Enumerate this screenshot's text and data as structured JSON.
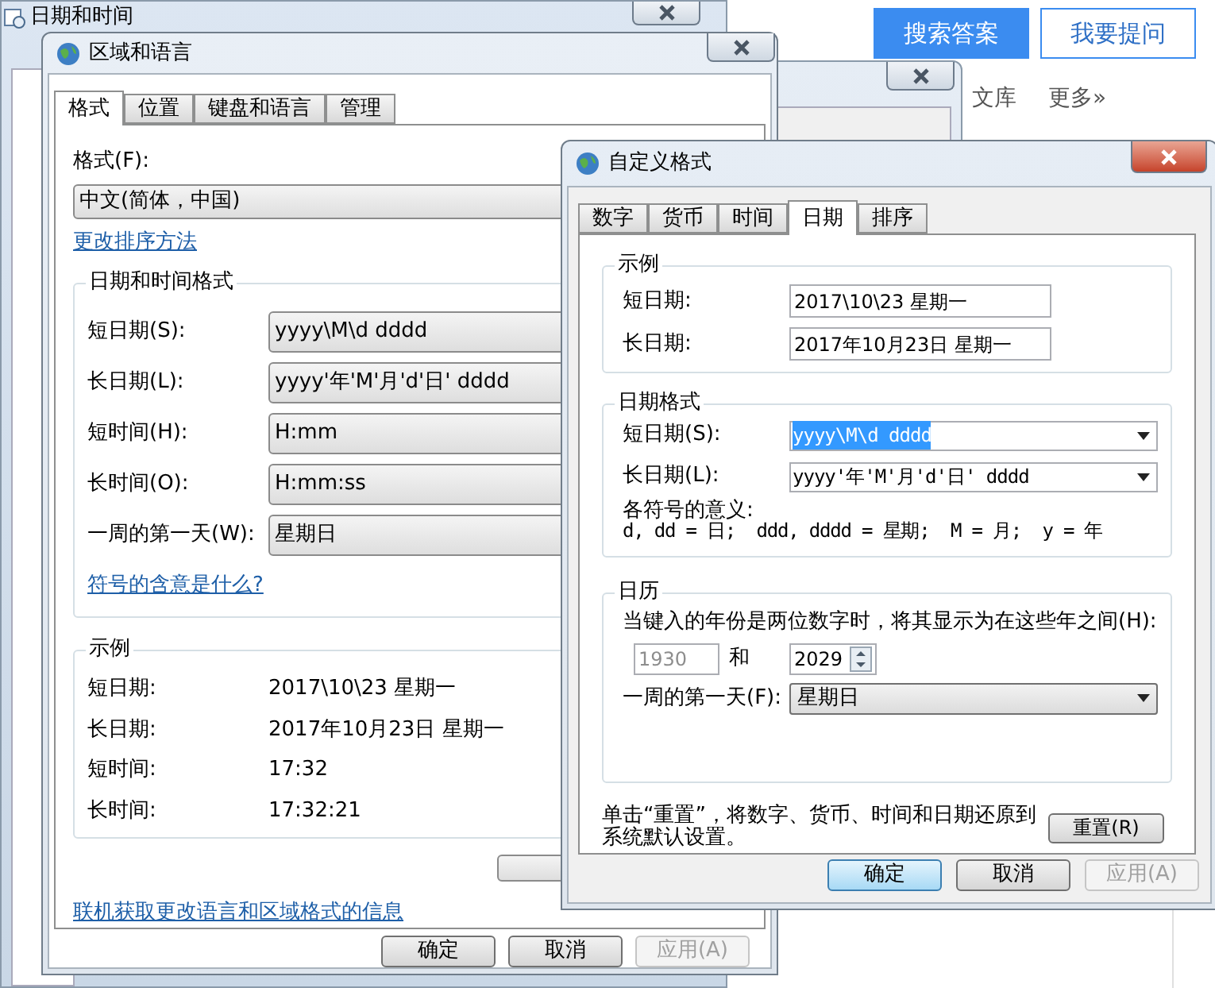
{
  "web_page": {
    "buttons": [
      {
        "label": "搜索答案",
        "kind": "primary"
      },
      {
        "label": "我要提问",
        "kind": "outline"
      }
    ],
    "nav_links": [
      "文库",
      "更多»"
    ]
  },
  "date_time_window": {
    "title": "日期和时间"
  },
  "region_dialog": {
    "title": "区域和语言",
    "tabs": [
      {
        "label": "格式",
        "selected": true
      },
      {
        "label": "位置",
        "selected": false
      },
      {
        "label": "键盘和语言",
        "selected": false
      },
      {
        "label": "管理",
        "selected": false
      }
    ],
    "format_label": "格式(F):",
    "format_value": "中文(简体，中国)",
    "sort_link": "更改排序方法",
    "formats_group": {
      "title": "日期和时间格式",
      "rows": [
        {
          "label": "短日期(S):",
          "value": "yyyy\\M\\d dddd"
        },
        {
          "label": "长日期(L):",
          "value": "yyyy'年'M'月'd'日' dddd"
        },
        {
          "label": "短时间(H):",
          "value": "H:mm"
        },
        {
          "label": "长时间(O):",
          "value": "H:mm:ss"
        },
        {
          "label": "一周的第一天(W):",
          "value": "星期日"
        }
      ]
    },
    "symbols_link": "符号的含意是什么?",
    "example_group": {
      "title": "示例",
      "rows": [
        {
          "label": "短日期:",
          "value": "2017\\10\\23 星期一"
        },
        {
          "label": "长日期:",
          "value": "2017年10月23日 星期一"
        },
        {
          "label": "短时间:",
          "value": "17:32"
        },
        {
          "label": "长时间:",
          "value": "17:32:21"
        }
      ]
    },
    "online_link": "联机获取更改语言和区域格式的信息",
    "buttons": [
      {
        "label": "确定",
        "disabled": false
      },
      {
        "label": "取消",
        "disabled": false
      },
      {
        "label": "应用(A)",
        "disabled": true
      }
    ]
  },
  "custom_dialog": {
    "title": "自定义格式",
    "tabs": [
      {
        "label": "数字",
        "selected": false
      },
      {
        "label": "货币",
        "selected": false
      },
      {
        "label": "时间",
        "selected": false
      },
      {
        "label": "日期",
        "selected": true
      },
      {
        "label": "排序",
        "selected": false
      }
    ],
    "example_group": {
      "title": "示例",
      "rows": [
        {
          "label": "短日期:",
          "value": "2017\\10\\23 星期一"
        },
        {
          "label": "长日期:",
          "value": "2017年10月23日 星期一"
        }
      ]
    },
    "format_group": {
      "title": "日期格式",
      "rows": [
        {
          "label": "短日期(S):",
          "value": "yyyy\\M\\d dddd",
          "text_selected": true
        },
        {
          "label": "长日期(L):",
          "value": "yyyy'年'M'月'd'日' dddd",
          "text_selected": false
        }
      ],
      "legend_title": "各符号的意义:",
      "legend_text": "d, dd = 日;  ddd, dddd = 星期;  M = 月;  y = 年"
    },
    "calendar_group": {
      "title": "日历",
      "range_text": "当键入的年份是两位数字时，将其显示为在这些年之间(H):",
      "from_year": {
        "value": "1930",
        "disabled": true
      },
      "and_label": "和",
      "to_year": {
        "value": "2029",
        "disabled": false
      },
      "first_day_label": "一周的第一天(F):",
      "first_day_value": "星期日"
    },
    "reset_text": "单击“重置”，将数字、货币、时间和日期还原到系统默认设置。",
    "reset_button": "重置(R)",
    "buttons": [
      {
        "label": "确定",
        "disabled": false,
        "focused": true
      },
      {
        "label": "取消",
        "disabled": false,
        "focused": false
      },
      {
        "label": "应用(A)",
        "disabled": true,
        "focused": false
      }
    ]
  }
}
